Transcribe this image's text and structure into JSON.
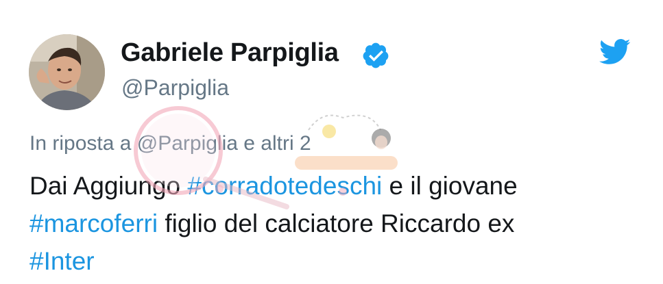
{
  "author": {
    "display_name": "Gabriele Parpiglia",
    "handle": "@Parpiglia",
    "verified": true,
    "avatar_icon": "profile-photo"
  },
  "brand": {
    "icon": "twitter-bird-icon",
    "color": "#1da1f2"
  },
  "reply": {
    "text": "In riposta a @Parpiglia e altri 2"
  },
  "tweet": {
    "line1": {
      "pre": "Dai Aggiungo ",
      "hashtag": "#corradotedeschi",
      "post": " e il giovane"
    },
    "line2": {
      "hashtag": "#marcoferri",
      "post": " figlio del calciatore Riccardo ex"
    },
    "line3": {
      "hashtag": "#Inter"
    }
  },
  "colors": {
    "hashtag": "#1b95e0",
    "secondary_text": "#657786",
    "verified_badge": "#1da1f2"
  }
}
